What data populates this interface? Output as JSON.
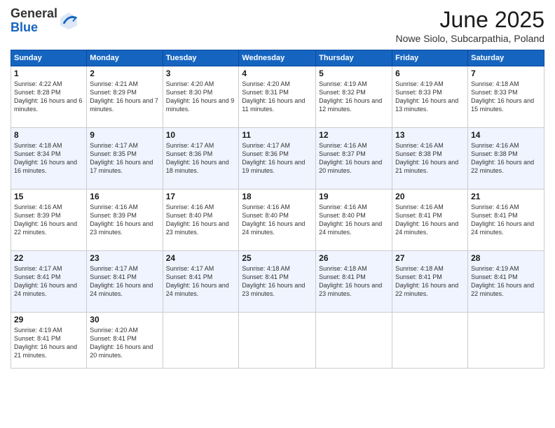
{
  "header": {
    "logo_line1": "General",
    "logo_line2": "Blue",
    "month": "June 2025",
    "location": "Nowe Siolo, Subcarpathia, Poland"
  },
  "days_of_week": [
    "Sunday",
    "Monday",
    "Tuesday",
    "Wednesday",
    "Thursday",
    "Friday",
    "Saturday"
  ],
  "weeks": [
    [
      {
        "day": "1",
        "sunrise": "4:22 AM",
        "sunset": "8:28 PM",
        "daylight": "16 hours and 6 minutes."
      },
      {
        "day": "2",
        "sunrise": "4:21 AM",
        "sunset": "8:29 PM",
        "daylight": "16 hours and 7 minutes."
      },
      {
        "day": "3",
        "sunrise": "4:20 AM",
        "sunset": "8:30 PM",
        "daylight": "16 hours and 9 minutes."
      },
      {
        "day": "4",
        "sunrise": "4:20 AM",
        "sunset": "8:31 PM",
        "daylight": "16 hours and 11 minutes."
      },
      {
        "day": "5",
        "sunrise": "4:19 AM",
        "sunset": "8:32 PM",
        "daylight": "16 hours and 12 minutes."
      },
      {
        "day": "6",
        "sunrise": "4:19 AM",
        "sunset": "8:33 PM",
        "daylight": "16 hours and 13 minutes."
      },
      {
        "day": "7",
        "sunrise": "4:18 AM",
        "sunset": "8:33 PM",
        "daylight": "16 hours and 15 minutes."
      }
    ],
    [
      {
        "day": "8",
        "sunrise": "4:18 AM",
        "sunset": "8:34 PM",
        "daylight": "16 hours and 16 minutes."
      },
      {
        "day": "9",
        "sunrise": "4:17 AM",
        "sunset": "8:35 PM",
        "daylight": "16 hours and 17 minutes."
      },
      {
        "day": "10",
        "sunrise": "4:17 AM",
        "sunset": "8:36 PM",
        "daylight": "16 hours and 18 minutes."
      },
      {
        "day": "11",
        "sunrise": "4:17 AM",
        "sunset": "8:36 PM",
        "daylight": "16 hours and 19 minutes."
      },
      {
        "day": "12",
        "sunrise": "4:16 AM",
        "sunset": "8:37 PM",
        "daylight": "16 hours and 20 minutes."
      },
      {
        "day": "13",
        "sunrise": "4:16 AM",
        "sunset": "8:38 PM",
        "daylight": "16 hours and 21 minutes."
      },
      {
        "day": "14",
        "sunrise": "4:16 AM",
        "sunset": "8:38 PM",
        "daylight": "16 hours and 22 minutes."
      }
    ],
    [
      {
        "day": "15",
        "sunrise": "4:16 AM",
        "sunset": "8:39 PM",
        "daylight": "16 hours and 22 minutes."
      },
      {
        "day": "16",
        "sunrise": "4:16 AM",
        "sunset": "8:39 PM",
        "daylight": "16 hours and 23 minutes."
      },
      {
        "day": "17",
        "sunrise": "4:16 AM",
        "sunset": "8:40 PM",
        "daylight": "16 hours and 23 minutes."
      },
      {
        "day": "18",
        "sunrise": "4:16 AM",
        "sunset": "8:40 PM",
        "daylight": "16 hours and 24 minutes."
      },
      {
        "day": "19",
        "sunrise": "4:16 AM",
        "sunset": "8:40 PM",
        "daylight": "16 hours and 24 minutes."
      },
      {
        "day": "20",
        "sunrise": "4:16 AM",
        "sunset": "8:41 PM",
        "daylight": "16 hours and 24 minutes."
      },
      {
        "day": "21",
        "sunrise": "4:16 AM",
        "sunset": "8:41 PM",
        "daylight": "16 hours and 24 minutes."
      }
    ],
    [
      {
        "day": "22",
        "sunrise": "4:17 AM",
        "sunset": "8:41 PM",
        "daylight": "16 hours and 24 minutes."
      },
      {
        "day": "23",
        "sunrise": "4:17 AM",
        "sunset": "8:41 PM",
        "daylight": "16 hours and 24 minutes."
      },
      {
        "day": "24",
        "sunrise": "4:17 AM",
        "sunset": "8:41 PM",
        "daylight": "16 hours and 24 minutes."
      },
      {
        "day": "25",
        "sunrise": "4:18 AM",
        "sunset": "8:41 PM",
        "daylight": "16 hours and 23 minutes."
      },
      {
        "day": "26",
        "sunrise": "4:18 AM",
        "sunset": "8:41 PM",
        "daylight": "16 hours and 23 minutes."
      },
      {
        "day": "27",
        "sunrise": "4:18 AM",
        "sunset": "8:41 PM",
        "daylight": "16 hours and 22 minutes."
      },
      {
        "day": "28",
        "sunrise": "4:19 AM",
        "sunset": "8:41 PM",
        "daylight": "16 hours and 22 minutes."
      }
    ],
    [
      {
        "day": "29",
        "sunrise": "4:19 AM",
        "sunset": "8:41 PM",
        "daylight": "16 hours and 21 minutes."
      },
      {
        "day": "30",
        "sunrise": "4:20 AM",
        "sunset": "8:41 PM",
        "daylight": "16 hours and 20 minutes."
      },
      null,
      null,
      null,
      null,
      null
    ]
  ]
}
